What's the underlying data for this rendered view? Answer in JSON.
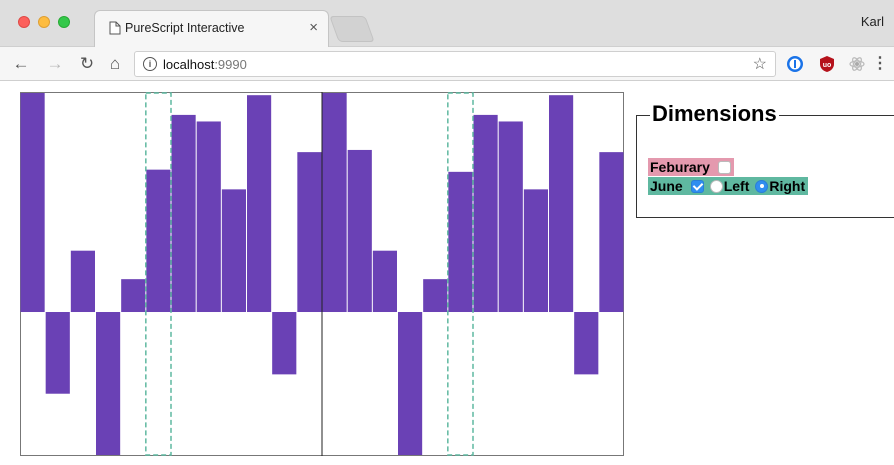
{
  "browser": {
    "tab_title": "PureScript Interactive",
    "tab_close": "×",
    "profile_name": "Karl",
    "url_host": "localhost",
    "url_port": ":9990",
    "icons": [
      "back-icon",
      "forward-icon",
      "reload-icon",
      "home-icon",
      "info-icon",
      "star-icon",
      "onepassword-icon",
      "ublock-icon",
      "extension-icon",
      "menu-icon"
    ]
  },
  "panel": {
    "legend": "Dimensions",
    "february_label": "Feburary",
    "february_checked": false,
    "june_label": "June",
    "june_checked": true,
    "left_label": "Left",
    "right_label": "Right",
    "selected_side": "Right"
  },
  "colors": {
    "bar": "#6a41b5",
    "highlight": "#5fb8a0",
    "february_bg": "#e499ae",
    "june_bg": "#5fb8a0"
  },
  "chart_data": {
    "type": "bar",
    "panels": 2,
    "baseline_fraction_from_top": 0.605,
    "ylim": [
      -0.665,
      1.0
    ],
    "highlight_index": 5,
    "series": [
      {
        "values": [
          1.0,
          -0.38,
          0.28,
          -0.85,
          0.15,
          0.65,
          0.9,
          0.87,
          0.56,
          0.99,
          -0.29,
          0.73
        ]
      },
      {
        "values": [
          1.0,
          0.74,
          0.28,
          -0.85,
          0.15,
          0.64,
          0.9,
          0.87,
          0.56,
          0.99,
          -0.29,
          0.73
        ]
      }
    ]
  }
}
